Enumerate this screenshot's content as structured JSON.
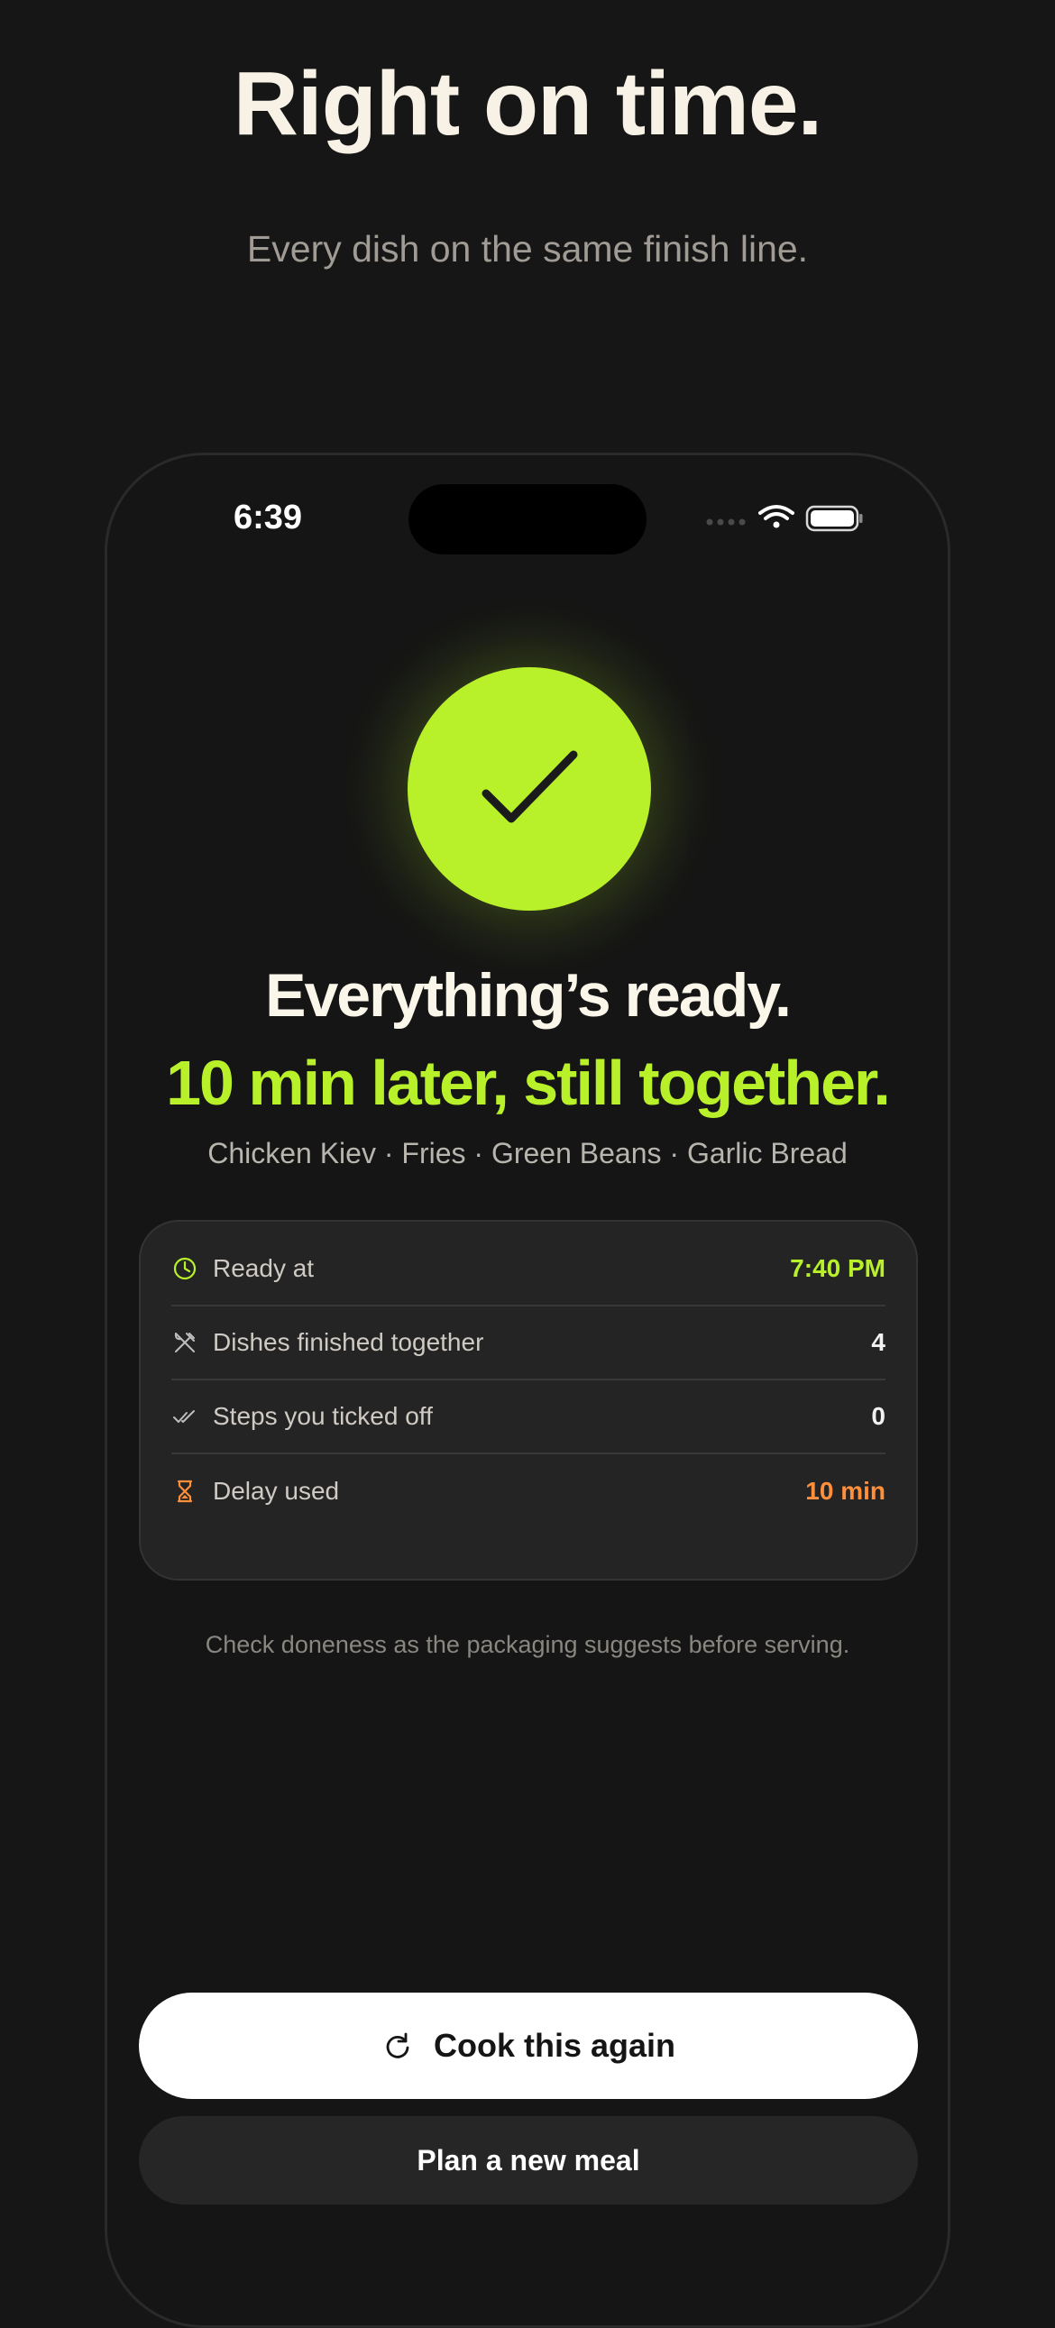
{
  "header": {
    "title": "Right on time.",
    "subtitle": "Every dish on the same finish line."
  },
  "status_bar": {
    "time": "6:39",
    "icons": [
      "signal-dots-icon",
      "wifi-icon",
      "battery-icon"
    ]
  },
  "result": {
    "icon": "checkmark-icon",
    "title": "Everything’s ready.",
    "accent": "10 min later, still together.",
    "dishes": "Chicken Kiev · Fries · Green Beans · Garlic Bread"
  },
  "summary": {
    "rows": [
      {
        "icon": "clock-icon",
        "label": "Ready at",
        "value": "7:40 PM",
        "color": "#b8f12a"
      },
      {
        "icon": "utensils-icon",
        "label": "Dishes finished together",
        "value": "4",
        "color": "#f2f2f2"
      },
      {
        "icon": "double-check-icon",
        "label": "Steps you ticked off",
        "value": "0",
        "color": "#f2f2f2"
      },
      {
        "icon": "hourglass-icon",
        "label": "Delay used",
        "value": "10 min",
        "color": "#ff8f3a"
      }
    ]
  },
  "note": "Check doneness as the packaging suggests before serving.",
  "actions": {
    "primary": "Cook this again",
    "secondary": "Plan a new meal"
  },
  "colors": {
    "accent": "#b8f12a",
    "warning": "#ff8f3a",
    "background": "#161616"
  }
}
